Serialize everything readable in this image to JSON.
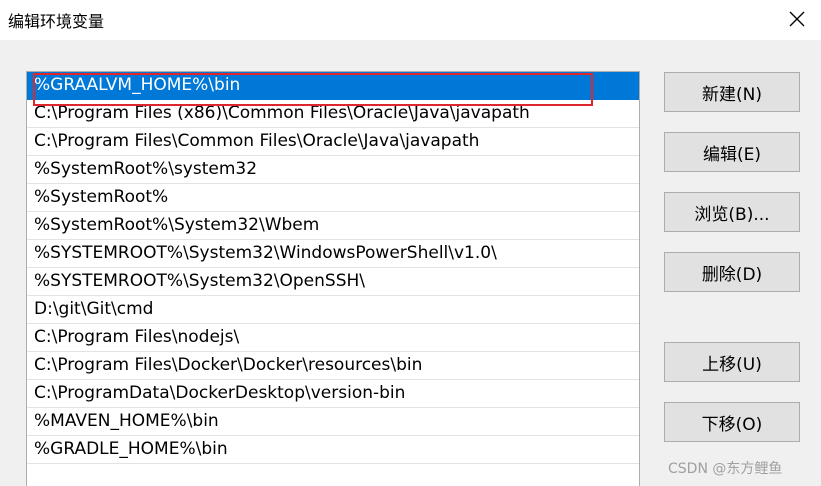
{
  "window": {
    "title": "编辑环境变量",
    "close_icon": "close-icon"
  },
  "path_list": {
    "selected_index": 0,
    "highlight_color": "#e0262a",
    "selection_color": "#0078d7",
    "items": [
      "%GRAALVM_HOME%\\bin",
      "C:\\Program Files (x86)\\Common Files\\Oracle\\Java\\javapath",
      "C:\\Program Files\\Common Files\\Oracle\\Java\\javapath",
      "%SystemRoot%\\system32",
      "%SystemRoot%",
      "%SystemRoot%\\System32\\Wbem",
      "%SYSTEMROOT%\\System32\\WindowsPowerShell\\v1.0\\",
      "%SYSTEMROOT%\\System32\\OpenSSH\\",
      "D:\\git\\Git\\cmd",
      "C:\\Program Files\\nodejs\\",
      "C:\\Program Files\\Docker\\Docker\\resources\\bin",
      "C:\\ProgramData\\DockerDesktop\\version-bin",
      "%MAVEN_HOME%\\bin",
      "%GRADLE_HOME%\\bin"
    ]
  },
  "buttons": {
    "new": "新建(N)",
    "edit": "编辑(E)",
    "browse": "浏览(B)...",
    "delete": "删除(D)",
    "move_up": "上移(U)",
    "move_down": "下移(O)"
  },
  "watermark": "CSDN @东方鲤鱼"
}
